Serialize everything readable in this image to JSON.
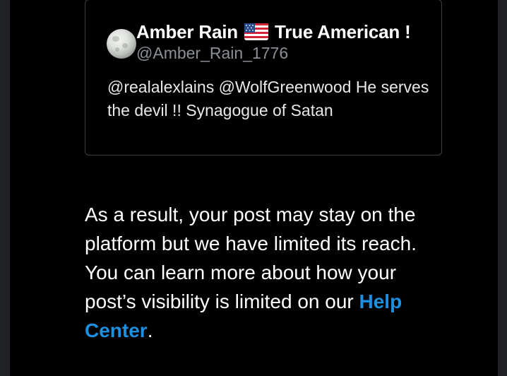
{
  "quoted_post": {
    "display_name_prefix": "Amber Rain",
    "flag_icon": "us-flag-emoji",
    "display_name_suffix": "True American !",
    "handle": "@Amber_Rain_1776",
    "text": "@realalexlains @WolfGreenwood He serves the devil !! Synagogue of Satan"
  },
  "notice": {
    "text": "As a result, your post may stay on the platform but we have limited its reach. You can learn more about how your post’s visibility is limited on our ",
    "link_label": "Help Center",
    "trailing": ".",
    "link_color": "#1d8fe0"
  },
  "colors": {
    "background": "#000000",
    "border": "#3b3e43",
    "handle": "#8b9097"
  }
}
